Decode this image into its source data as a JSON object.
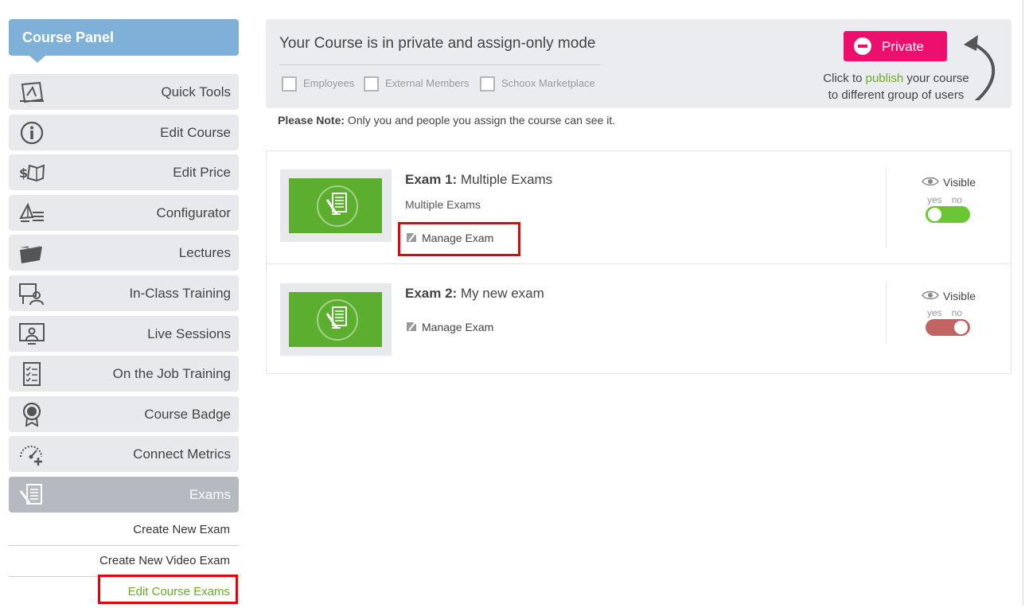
{
  "sidebar": {
    "title": "Course Panel",
    "items": [
      {
        "label": "Quick Tools",
        "icon": "quick-tools-icon"
      },
      {
        "label": "Edit Course",
        "icon": "info-icon"
      },
      {
        "label": "Edit Price",
        "icon": "price-icon"
      },
      {
        "label": "Configurator",
        "icon": "configurator-icon"
      },
      {
        "label": "Lectures",
        "icon": "folder-icon"
      },
      {
        "label": "In-Class Training",
        "icon": "classroom-icon"
      },
      {
        "label": "Live Sessions",
        "icon": "live-session-icon"
      },
      {
        "label": "On the Job Training",
        "icon": "checklist-icon"
      },
      {
        "label": "Course Badge",
        "icon": "badge-icon"
      },
      {
        "label": "Connect Metrics",
        "icon": "metrics-icon"
      },
      {
        "label": "Exams",
        "icon": "exam-icon",
        "active": true
      }
    ],
    "subitems": [
      {
        "label": "Create New Exam"
      },
      {
        "label": "Create New Video Exam"
      },
      {
        "label": "Edit Course Exams",
        "current": true
      }
    ]
  },
  "privacy": {
    "title": "Your Course is in private and assign-only mode",
    "checkboxes": [
      "Employees",
      "External Members",
      "Schoox Marketplace"
    ],
    "button_label": "Private",
    "help_pre": "Click to ",
    "help_link": "publish",
    "help_post": " your course",
    "help_line2": "to different group of users"
  },
  "note": {
    "bold": "Please Note:",
    "text": " Only you and people you assign the course can see it."
  },
  "exams": [
    {
      "prefix": "Exam 1:",
      "title": " Multiple Exams",
      "subtitle": "Multiple Exams",
      "manage_label": "Manage Exam",
      "visible_label": "Visible",
      "yes": "yes",
      "no": "no",
      "visible": true
    },
    {
      "prefix": "Exam 2:",
      "title": " My new exam",
      "subtitle": "",
      "manage_label": "Manage Exam",
      "visible_label": "Visible",
      "yes": "yes",
      "no": "no",
      "visible": false
    }
  ],
  "colors": {
    "panel_head": "#7fb0d8",
    "private_button": "#ec0f6e",
    "accent_green": "#6aaa2a",
    "toggle_on": "#6bc634",
    "toggle_off": "#c26464",
    "highlight": "#e8000b"
  }
}
